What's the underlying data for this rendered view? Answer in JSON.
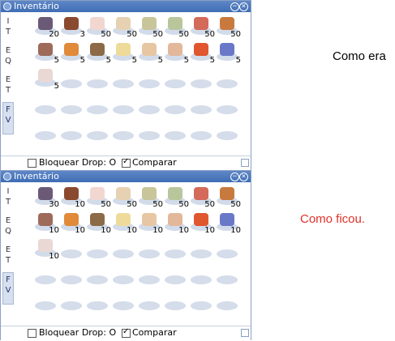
{
  "colors": {
    "caption_before": "#000000",
    "caption_after": "#e0312a"
  },
  "captions": {
    "before": "Como era",
    "after": "Como ficou."
  },
  "panels": [
    {
      "title": "Inventário",
      "tabs": [
        {
          "lines": [
            "I",
            "T"
          ]
        },
        {
          "lines": [
            "E",
            "Q"
          ]
        },
        {
          "lines": [
            "E",
            "T"
          ]
        },
        {
          "lines": [
            "F",
            "V"
          ]
        }
      ],
      "items": [
        {
          "count": "20",
          "color": "#6a5a78"
        },
        {
          "count": "3",
          "color": "#8a4a30"
        },
        {
          "count": "50",
          "color": "#f1d7d0"
        },
        {
          "count": "50",
          "color": "#e6d2b2"
        },
        {
          "count": "50",
          "color": "#c8c59a"
        },
        {
          "count": "50",
          "color": "#b9c69b"
        },
        {
          "count": "50",
          "color": "#d36a5a"
        },
        {
          "count": "50",
          "color": "#c87a3e"
        },
        {
          "count": "5",
          "color": "#9e6a5a"
        },
        {
          "count": "5",
          "color": "#e08a3a"
        },
        {
          "count": "5",
          "color": "#8c6a48"
        },
        {
          "count": "5",
          "color": "#eedb9a"
        },
        {
          "count": "5",
          "color": "#e7c7a3"
        },
        {
          "count": "5",
          "color": "#e3b89a"
        },
        {
          "count": "5",
          "color": "#e0562e"
        },
        {
          "count": "5",
          "color": "#6a78c8"
        },
        {
          "count": "5",
          "color": "#ead8d4"
        }
      ],
      "footer": {
        "drop_label": "Bloquear Drop: O",
        "compare_label": "Comparar"
      }
    },
    {
      "title": "Inventário",
      "tabs": [
        {
          "lines": [
            "I",
            "T"
          ]
        },
        {
          "lines": [
            "E",
            "Q"
          ]
        },
        {
          "lines": [
            "E",
            "T"
          ]
        },
        {
          "lines": [
            "F",
            "V"
          ]
        }
      ],
      "items": [
        {
          "count": "30",
          "color": "#6a5a78"
        },
        {
          "count": "10",
          "color": "#8a4a30"
        },
        {
          "count": "50",
          "color": "#f1d7d0"
        },
        {
          "count": "50",
          "color": "#e6d2b2"
        },
        {
          "count": "50",
          "color": "#c8c59a"
        },
        {
          "count": "50",
          "color": "#b9c69b"
        },
        {
          "count": "50",
          "color": "#d36a5a"
        },
        {
          "count": "50",
          "color": "#c87a3e"
        },
        {
          "count": "10",
          "color": "#9e6a5a"
        },
        {
          "count": "10",
          "color": "#e08a3a"
        },
        {
          "count": "10",
          "color": "#8c6a48"
        },
        {
          "count": "10",
          "color": "#eedb9a"
        },
        {
          "count": "10",
          "color": "#e7c7a3"
        },
        {
          "count": "10",
          "color": "#e3b89a"
        },
        {
          "count": "10",
          "color": "#e0562e"
        },
        {
          "count": "10",
          "color": "#6a78c8"
        },
        {
          "count": "10",
          "color": "#ead8d4"
        }
      ],
      "footer": {
        "drop_label": "Bloquear Drop: O",
        "compare_label": "Comparar"
      }
    }
  ]
}
